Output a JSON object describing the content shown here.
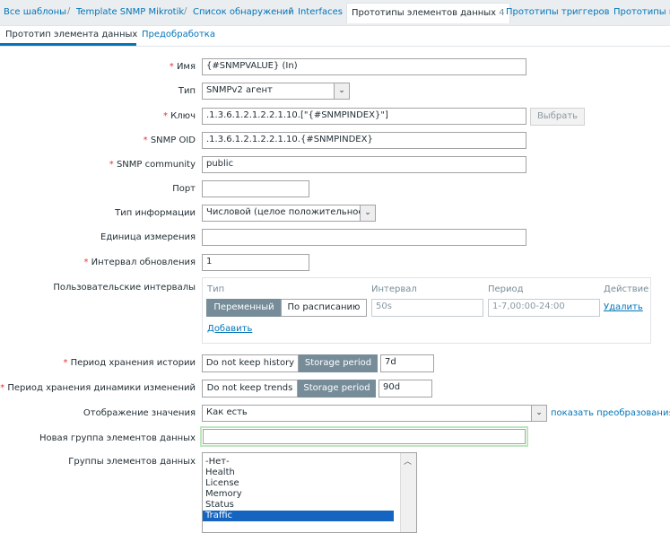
{
  "breadcrumb": {
    "items": [
      "Все шаблоны",
      "Template SNMP Mikrotik",
      "Список обнаружений",
      "Interfaces"
    ],
    "separator": "/",
    "active_label": "Прототипы элементов данных",
    "active_count": "4",
    "after": [
      "Прототипы триггеров",
      "Прототипы г"
    ]
  },
  "tabs": {
    "item_prototype": "Прототип элемента данных",
    "preprocessing": "Предобработка"
  },
  "form": {
    "name": {
      "label": "Имя",
      "value": "{#SNMPVALUE} (In)"
    },
    "type": {
      "label": "Тип",
      "value": "SNMPv2 агент"
    },
    "key": {
      "label": "Ключ",
      "value": ".1.3.6.1.2.1.2.2.1.10.[\"{#SNMPINDEX}\"]",
      "button": "Выбрать"
    },
    "snmp_oid": {
      "label": "SNMP OID",
      "value": ".1.3.6.1.2.1.2.2.1.10.{#SNMPINDEX}"
    },
    "snmp_community": {
      "label": "SNMP community",
      "value": "public"
    },
    "port": {
      "label": "Порт",
      "value": ""
    },
    "info_type": {
      "label": "Тип информации",
      "value": "Числовой (целое положительное)"
    },
    "units": {
      "label": "Единица измерения",
      "value": ""
    },
    "update_interval": {
      "label": "Интервал обновления",
      "value": "1"
    },
    "custom_intervals": {
      "label": "Пользовательские интервалы",
      "headers": {
        "type": "Тип",
        "interval": "Интервал",
        "period": "Период",
        "action": "Действие"
      },
      "flexible": "Переменный",
      "scheduling": "По расписанию",
      "interval_placeholder": "50s",
      "period_placeholder": "1-7,00:00-24:00",
      "remove": "Удалить",
      "add": "Добавить"
    },
    "history": {
      "label": "Период хранения истории",
      "option_off": "Do not keep history",
      "option_on": "Storage period",
      "value": "7d"
    },
    "trends": {
      "label": "Период хранения динамики изменений",
      "option_off": "Do not keep trends",
      "option_on": "Storage period",
      "value": "90d"
    },
    "show_value": {
      "label": "Отображение значения",
      "value": "Как есть",
      "link": "показать преобразования з"
    },
    "new_app": {
      "label": "Новая группа элементов данных",
      "value": ""
    },
    "apps": {
      "label": "Группы элементов данных",
      "options": [
        "-Нет-",
        "Health",
        "License",
        "Memory",
        "Status",
        "Traffic"
      ],
      "selected": "Traffic"
    }
  },
  "colors": {
    "accent": "#0275b8",
    "required": "#e33734",
    "segment_on": "#768d99",
    "list_selected": "#1565c0",
    "focus_border": "#bfe5bf"
  }
}
